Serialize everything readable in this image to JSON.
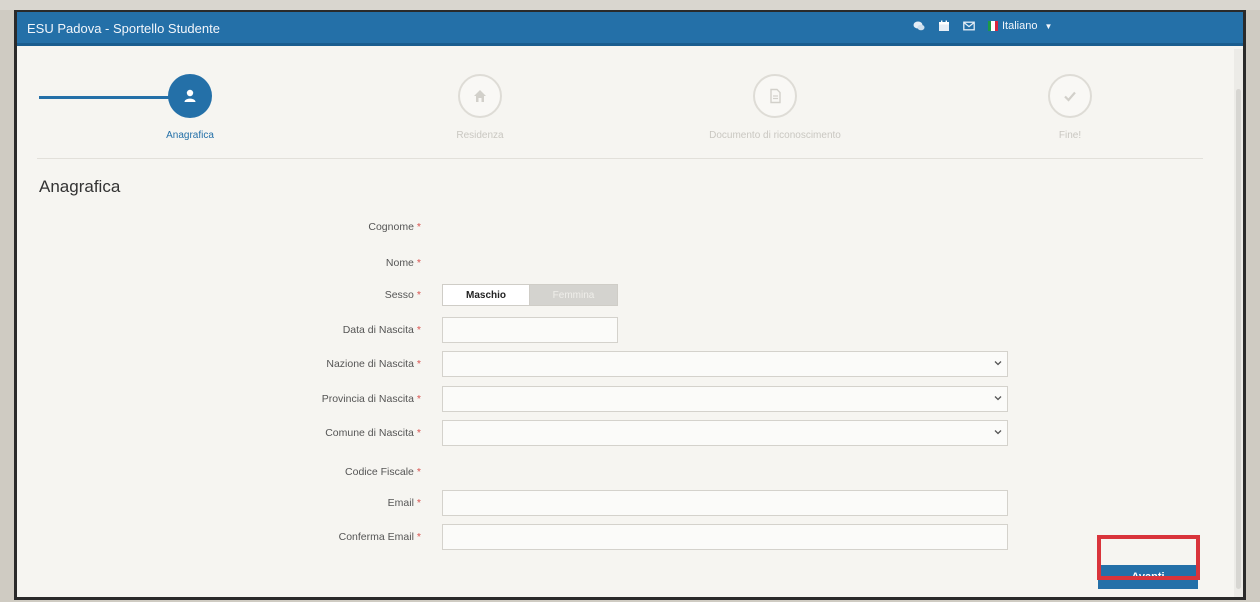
{
  "window": {
    "title": "ESU Padova - Sportello Studente",
    "language": "Italiano"
  },
  "colors": {
    "primary": "#2470a8",
    "required": "#d9534f",
    "highlight": "#d9343b"
  },
  "wizard": {
    "steps": [
      {
        "label": "Anagrafica",
        "icon": "user-icon",
        "state": "active"
      },
      {
        "label": "Residenza",
        "icon": "home-icon",
        "state": "inactive"
      },
      {
        "label": "Documento di riconoscimento",
        "icon": "document-icon",
        "state": "inactive"
      },
      {
        "label": "Fine!",
        "icon": "check-icon",
        "state": "inactive"
      }
    ]
  },
  "form": {
    "section_title": "Anagrafica",
    "required_mark": "*",
    "fields": {
      "cognome": {
        "label": "Cognome",
        "value": ""
      },
      "nome": {
        "label": "Nome",
        "value": ""
      },
      "sesso": {
        "label": "Sesso",
        "options": [
          "Maschio",
          "Femmina"
        ],
        "selected": "Maschio"
      },
      "data_nascita": {
        "label": "Data di Nascita",
        "value": ""
      },
      "nazione_nascita": {
        "label": "Nazione di Nascita",
        "value": ""
      },
      "provincia_nascita": {
        "label": "Provincia di Nascita",
        "value": ""
      },
      "comune_nascita": {
        "label": "Comune di Nascita",
        "value": ""
      },
      "codice_fiscale": {
        "label": "Codice Fiscale",
        "value": ""
      },
      "email": {
        "label": "Email",
        "value": ""
      },
      "conferma_email": {
        "label": "Conferma Email",
        "value": ""
      }
    },
    "next_label": "Avanti"
  }
}
